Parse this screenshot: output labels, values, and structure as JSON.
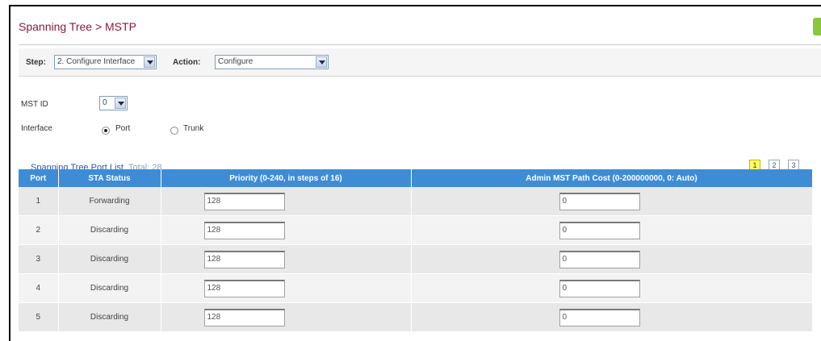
{
  "breadcrumb": "Spanning Tree > MSTP",
  "toolbar": {
    "step_label": "Step:",
    "step_value": "2. Configure Interface",
    "action_label": "Action:",
    "action_value": "Configure"
  },
  "form": {
    "mst_id_label": "MST ID",
    "mst_id_value": "0",
    "interface_label": "Interface",
    "port_label": "Port",
    "trunk_label": "Trunk",
    "interface_selected": "Port"
  },
  "list": {
    "title": "Spanning Tree Port List",
    "total": "Total: 28",
    "pages": [
      "1",
      "2",
      "3"
    ],
    "current_page": "1"
  },
  "table": {
    "columns": [
      "Port",
      "STA Status",
      "Priority (0-240, in steps of 16)",
      "Admin MST Path Cost (0-200000000, 0: Auto)"
    ],
    "rows": [
      {
        "port": "1",
        "status": "Forwarding",
        "priority": "128",
        "cost": "0"
      },
      {
        "port": "2",
        "status": "Discarding",
        "priority": "128",
        "cost": "0"
      },
      {
        "port": "3",
        "status": "Discarding",
        "priority": "128",
        "cost": "0"
      },
      {
        "port": "4",
        "status": "Discarding",
        "priority": "128",
        "cost": "0"
      },
      {
        "port": "5",
        "status": "Discarding",
        "priority": "128",
        "cost": "0"
      }
    ]
  },
  "colors": {
    "breadcrumb": "#8b1a3a",
    "header_bg": "#3f8cd6",
    "link": "#1f5ea8",
    "current_page_bg": "#ffff66"
  }
}
